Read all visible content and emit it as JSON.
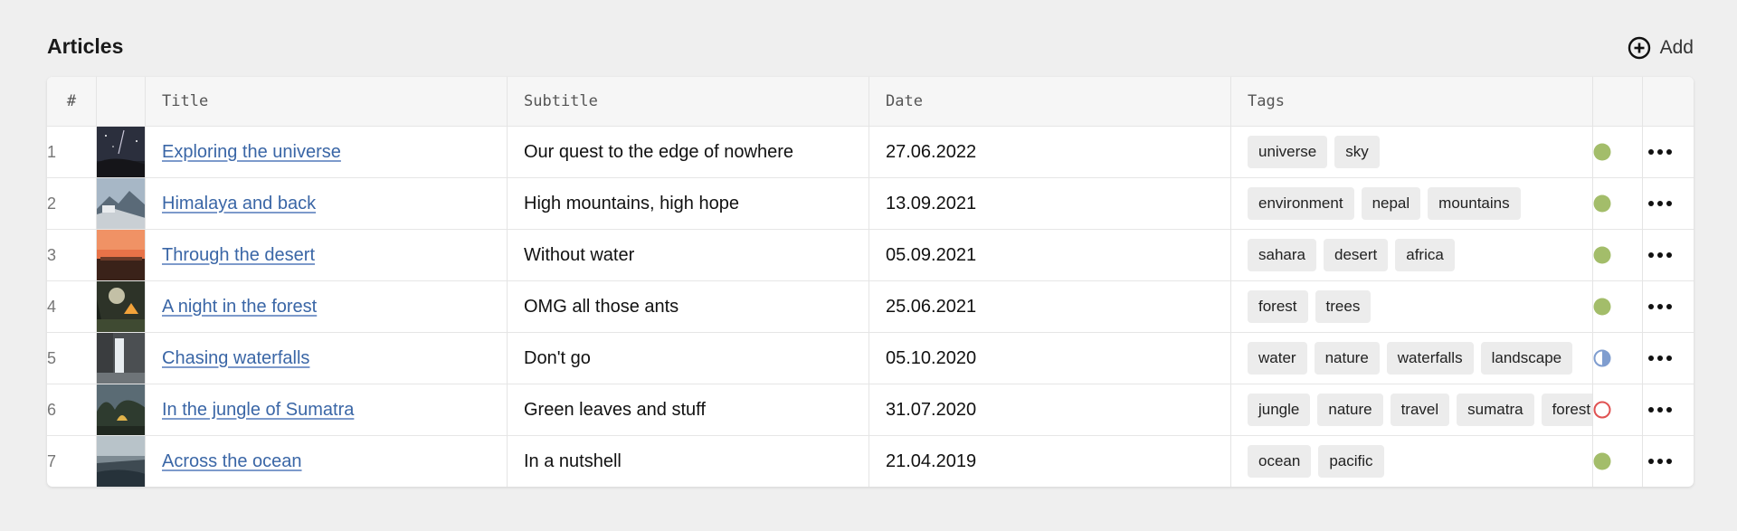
{
  "page": {
    "title": "Articles",
    "add_label": "Add"
  },
  "columns": {
    "num": "#",
    "thumb": "",
    "title": "Title",
    "subtitle": "Subtitle",
    "date": "Date",
    "tags": "Tags",
    "status": "",
    "menu": ""
  },
  "colors": {
    "link": "#3a66a6",
    "status_published": "#a3bd6a",
    "status_partial": "#7f9dcf",
    "status_draft": "#e05252"
  },
  "rows": [
    {
      "num": "1",
      "title": "Exploring the universe",
      "subtitle": "Our quest to the edge of nowhere",
      "date": "27.06.2022",
      "tags": [
        "universe",
        "sky"
      ],
      "status": "published",
      "thumb": "night-sky"
    },
    {
      "num": "2",
      "title": "Himalaya and back",
      "subtitle": "High mountains, high hope",
      "date": "13.09.2021",
      "tags": [
        "environment",
        "nepal",
        "mountains"
      ],
      "status": "published",
      "thumb": "mountains"
    },
    {
      "num": "3",
      "title": "Through the desert",
      "subtitle": "Without water",
      "date": "05.09.2021",
      "tags": [
        "sahara",
        "desert",
        "africa"
      ],
      "status": "published",
      "thumb": "desert-sunset"
    },
    {
      "num": "4",
      "title": "A night in the forest",
      "subtitle": "OMG all those ants",
      "date": "25.06.2021",
      "tags": [
        "forest",
        "trees"
      ],
      "status": "published",
      "thumb": "forest-tent"
    },
    {
      "num": "5",
      "title": "Chasing waterfalls",
      "subtitle": "Don't go",
      "date": "05.10.2020",
      "tags": [
        "water",
        "nature",
        "waterfalls",
        "landscape"
      ],
      "status": "partial",
      "thumb": "waterfall"
    },
    {
      "num": "6",
      "title": "In the jungle of Sumatra",
      "subtitle": "Green leaves and stuff",
      "date": "31.07.2020",
      "tags": [
        "jungle",
        "nature",
        "travel",
        "sumatra",
        "forest"
      ],
      "status": "draft",
      "thumb": "jungle"
    },
    {
      "num": "7",
      "title": "Across the ocean",
      "subtitle": "In a nutshell",
      "date": "21.04.2019",
      "tags": [
        "ocean",
        "pacific"
      ],
      "status": "published",
      "thumb": "ocean"
    }
  ]
}
